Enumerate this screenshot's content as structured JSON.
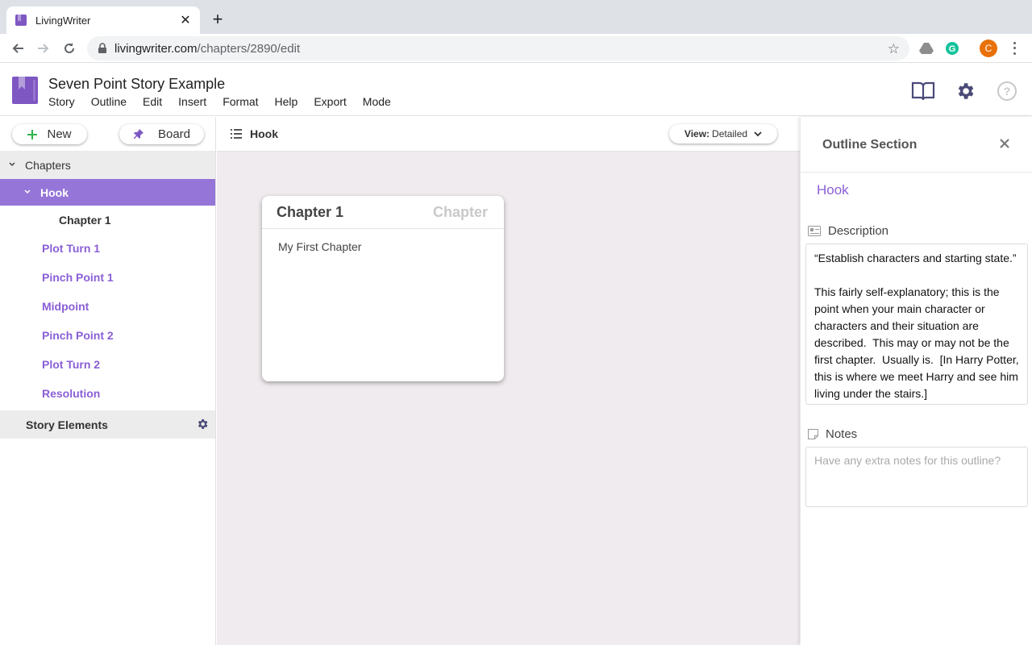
{
  "browser": {
    "tab_title": "LivingWriter",
    "url_host": "livingwriter.com",
    "url_path": "/chapters/2890/edit",
    "profile_initial": "C"
  },
  "app": {
    "doc_title": "Seven Point Story Example",
    "menu": [
      "Story",
      "Outline",
      "Edit",
      "Insert",
      "Format",
      "Help",
      "Export",
      "Mode"
    ],
    "accent_color": "#8a5fd6"
  },
  "sidebar": {
    "new_label": "New",
    "board_label": "Board",
    "chapters_label": "Chapters",
    "hook_label": "Hook",
    "chapter1_label": "Chapter 1",
    "items": [
      "Plot Turn 1",
      "Pinch Point 1",
      "Midpoint",
      "Pinch Point 2",
      "Plot Turn 2",
      "Resolution"
    ],
    "story_elements_label": "Story Elements"
  },
  "main": {
    "breadcrumb": "Hook",
    "view_prefix": "View:",
    "view_value": "Detailed",
    "card": {
      "title": "Chapter 1",
      "type": "Chapter",
      "body": "My First Chapter"
    }
  },
  "panel": {
    "title": "Outline Section",
    "section_name": "Hook",
    "description_label": "Description",
    "description_text": "“Establish characters and starting state.”\n\nThis fairly self-explanatory; this is the point when your main character or characters and their situation are described.  This may or may not be the first chapter.  Usually is.  [In Harry Potter, this is where we meet Harry and see him living under the stairs.]",
    "notes_label": "Notes",
    "notes_placeholder": "Have any extra notes for this outline?"
  }
}
